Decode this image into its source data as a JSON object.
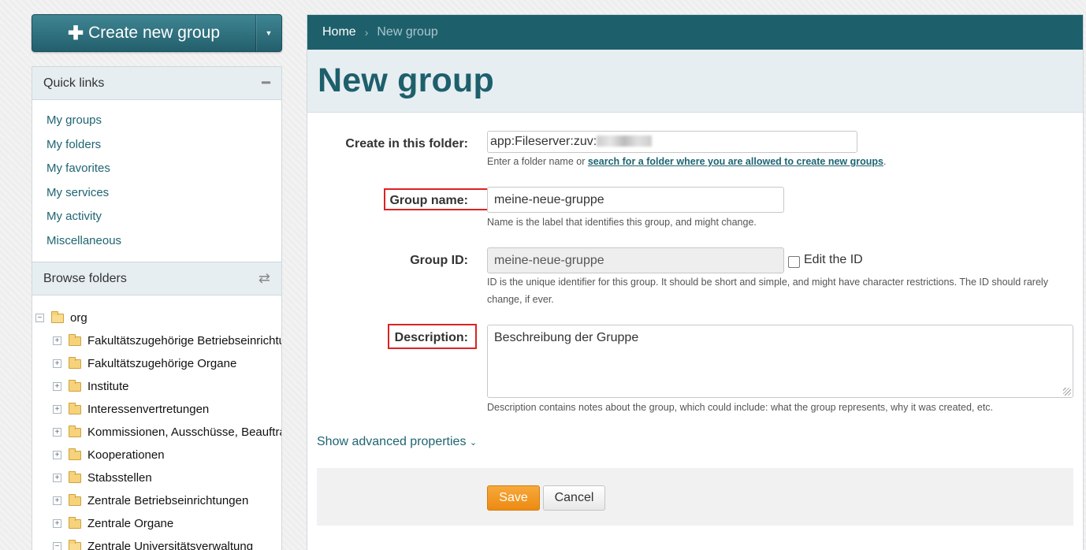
{
  "sidebar": {
    "create_button": {
      "label": "Create new group"
    },
    "quick_links": {
      "title": "Quick links",
      "items": [
        "My groups",
        "My folders",
        "My favorites",
        "My services",
        "My activity",
        "Miscellaneous"
      ]
    },
    "browse_folders": {
      "title": "Browse folders",
      "root": "org",
      "children": [
        "Fakultätszugehörige Betriebseinrichtungen",
        "Fakultätszugehörige Organe",
        "Institute",
        "Interessenvertretungen",
        "Kommissionen, Ausschüsse, Beauftragte",
        "Kooperationen",
        "Stabsstellen",
        "Zentrale Betriebseinrichtungen",
        "Zentrale Organe",
        "Zentrale Universitätsverwaltung"
      ]
    }
  },
  "breadcrumb": {
    "home": "Home",
    "current": "New group"
  },
  "page_title": "New group",
  "form": {
    "folder": {
      "label": "Create in this folder:",
      "value": "app:Fileserver:zuv:",
      "help_prefix": "Enter a folder name or ",
      "help_link": "search for a folder where you are allowed to create new groups",
      "help_suffix": "."
    },
    "group_name": {
      "label": "Group name:",
      "value": "meine-neue-gruppe",
      "help": "Name is the label that identifies this group, and might change."
    },
    "group_id": {
      "label": "Group ID:",
      "value": "meine-neue-gruppe",
      "edit_label": "Edit the ID",
      "help_line1": "ID is the unique identifier for this group. It should be short and simple, and might have character restrictions. The ID should rarely",
      "help_line2": "change, if ever."
    },
    "description": {
      "label": "Description:",
      "value": "Beschreibung der Gruppe",
      "help": "Description contains notes about the group, which could include: what the group represents, why it was created, etc."
    },
    "advanced_link": "Show advanced properties",
    "save_label": "Save",
    "cancel_label": "Cancel"
  },
  "colors": {
    "primary": "#1e5f6c",
    "accent_save": "#f0951f",
    "highlight": "#dd2222"
  }
}
